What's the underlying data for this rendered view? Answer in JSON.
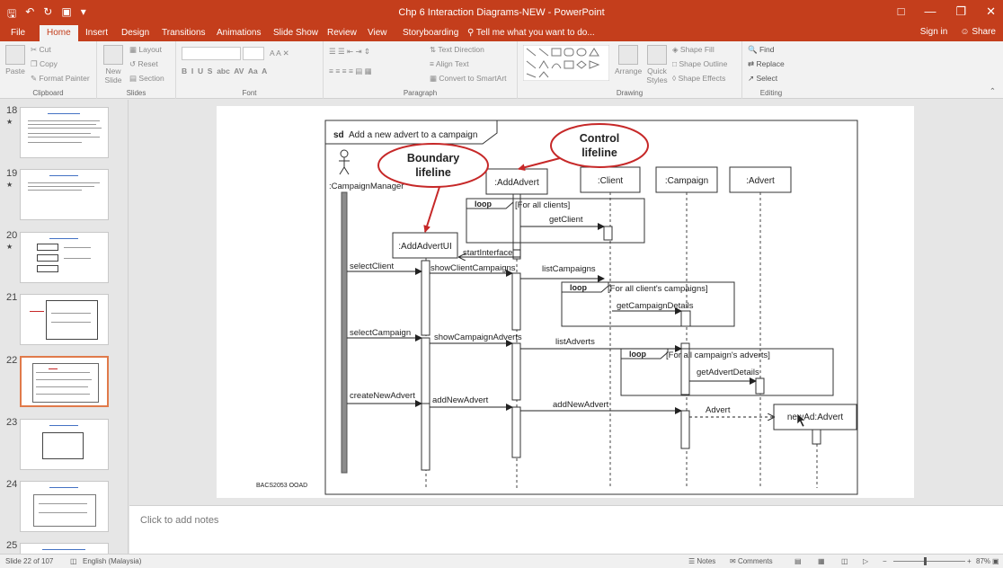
{
  "window": {
    "title": "Chp 6 Interaction Diagrams-NEW - PowerPoint",
    "accent": "#c43e1c"
  },
  "qat": [
    "save-icon",
    "undo-icon",
    "redo-icon",
    "present-icon",
    "customize-icon"
  ],
  "tabs": [
    "File",
    "Home",
    "Insert",
    "Design",
    "Transitions",
    "Animations",
    "Slide Show",
    "Review",
    "View",
    "Storyboarding"
  ],
  "tell_me": "Tell me what you want to do...",
  "account": {
    "signin": "Sign in",
    "share": "Share"
  },
  "ribbon": {
    "clipboard": {
      "label": "Clipboard",
      "paste": "Paste",
      "cut": "Cut",
      "copy": "Copy",
      "format_painter": "Format Painter"
    },
    "slides": {
      "label": "Slides",
      "new_slide": "New Slide",
      "layout": "Layout",
      "reset": "Reset",
      "section": "Section"
    },
    "font": {
      "label": "Font"
    },
    "paragraph": {
      "label": "Paragraph",
      "text_direction": "Text Direction",
      "align_text": "Align Text",
      "convert": "Convert to SmartArt"
    },
    "drawing": {
      "label": "Drawing",
      "arrange": "Arrange",
      "quick_styles": "Quick Styles",
      "shape_fill": "Shape Fill",
      "shape_outline": "Shape Outline",
      "shape_effects": "Shape Effects"
    },
    "editing": {
      "label": "Editing",
      "find": "Find",
      "replace": "Replace",
      "select": "Select"
    }
  },
  "thumbnails": [
    {
      "num": "18",
      "star": "★"
    },
    {
      "num": "19",
      "star": "★"
    },
    {
      "num": "20",
      "star": "★"
    },
    {
      "num": "21",
      "star": ""
    },
    {
      "num": "22",
      "star": ""
    },
    {
      "num": "23",
      "star": ""
    },
    {
      "num": "24",
      "star": ""
    },
    {
      "num": "25",
      "star": ""
    }
  ],
  "slide": {
    "frame_label_sd": "sd",
    "frame_title": "Add a new advert to a campaign",
    "actor": ":CampaignManager",
    "lifelines": {
      "add_advert": ":AddAdvert",
      "client": ":Client",
      "campaign": ":Campaign",
      "advert": ":Advert",
      "add_advert_ui": ":AddAdvertUI",
      "new_ad": "newAd:Advert"
    },
    "callouts": {
      "boundary_line1": "Boundary",
      "boundary_line2": "lifeline",
      "control_line1": "Control",
      "control_line2": "lifeline",
      "color": "#c62828"
    },
    "loops": {
      "keyword": "loop",
      "guard1": "[For all clients]",
      "guard2": "[For all client's campaigns]",
      "guard3": "[For all campaign's adverts]"
    },
    "messages": {
      "get_client": "getClient",
      "start_interface": "startInterface",
      "select_client": "selectClient",
      "show_client_campaigns": "showClientCampaigns",
      "list_campaigns": "listCampaigns",
      "get_campaign_details": "getCampaignDetails",
      "select_campaign": "selectCampaign",
      "show_campaign_adverts": "showCampaignAdverts",
      "list_adverts": "listAdverts",
      "get_advert_details": "getAdvertDetails",
      "create_new_advert": "createNewAdvert",
      "add_new_advert_1": "addNewAdvert",
      "add_new_advert_2": "addNewAdvert",
      "advert_create": "Advert"
    },
    "footer": "BACS2053 OOAD"
  },
  "notes_placeholder": "Click to add notes",
  "status": {
    "slide_of": "Slide 22 of 107",
    "language": "English (Malaysia)",
    "notes": "Notes",
    "comments": "Comments",
    "zoom": "87%"
  }
}
